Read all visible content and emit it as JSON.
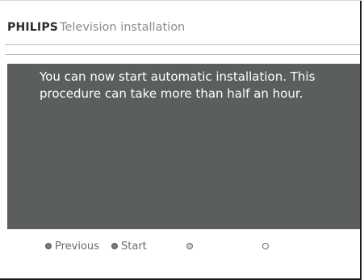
{
  "header": {
    "brand": "PHILIPS",
    "title": "Television installation"
  },
  "panel": {
    "message_lines": [
      "You can now start automatic installation. This",
      "procedure can take more than half an hour."
    ]
  },
  "footer": {
    "buttons": [
      {
        "label": "Previous",
        "icon": "red-dot-icon"
      },
      {
        "label": "Start",
        "icon": "green-dot-icon"
      },
      {
        "label": "",
        "icon": "yellow-dot-icon"
      },
      {
        "label": "",
        "icon": "blue-dot-icon"
      }
    ]
  }
}
